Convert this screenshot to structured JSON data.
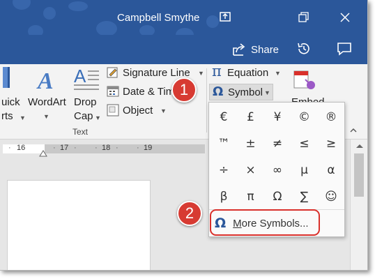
{
  "window": {
    "user_name": "Campbell Smythe",
    "share_label": "Share"
  },
  "ribbon": {
    "quick_parts_lines": [
      "uick",
      "rts"
    ],
    "wordart_label": "WordArt",
    "dropcap_lines": [
      "Drop",
      "Cap"
    ],
    "signature_line_label": "Signature Line",
    "date_time_label": "Date & Time",
    "object_label": "Object",
    "group_label": "Text",
    "equation_label": "Equation",
    "symbol_label": "Symbol",
    "embed_label": "Embed"
  },
  "ruler": {
    "labels": [
      "16",
      "17",
      "18",
      "19"
    ]
  },
  "symbol_menu": {
    "rows": [
      [
        "€",
        "£",
        "¥",
        "©",
        "®"
      ],
      [
        "™",
        "±",
        "≠",
        "≤",
        "≥"
      ],
      [
        "÷",
        "×",
        "∞",
        "µ",
        "α"
      ],
      [
        "β",
        "π",
        "Ω",
        "∑",
        "☺"
      ]
    ],
    "more_label": "More Symbols..."
  },
  "callouts": [
    "1",
    "2"
  ],
  "colors": {
    "title_bar": "#2b579a",
    "ribbon_bg": "#f3f3f3",
    "accent_blue": "#2b579a",
    "callout_red": "#d73a32"
  }
}
